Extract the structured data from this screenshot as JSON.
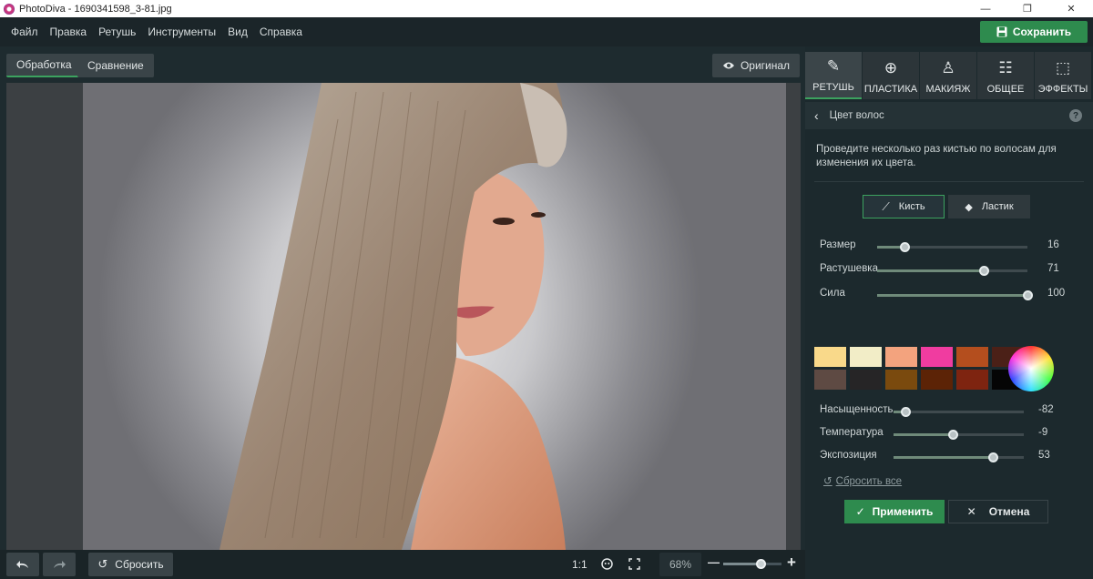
{
  "window": {
    "title": "PhotoDiva - 1690341598_3-81.jpg",
    "minimize": "—",
    "maximize": "❐",
    "close": "✕"
  },
  "menu": [
    "Файл",
    "Правка",
    "Ретушь",
    "Инструменты",
    "Вид",
    "Справка"
  ],
  "save_label": "Сохранить",
  "view_tabs": {
    "processing": "Обработка",
    "compare": "Сравнение"
  },
  "original_label": "Оригинал",
  "bottom": {
    "reset_label": "Сбросить",
    "ratio_label": "1:1",
    "zoom_label": "68%",
    "zoom_value": 0.68,
    "minus": "—",
    "plus": "+"
  },
  "right_tabs": [
    {
      "label": "РЕТУШЬ",
      "icon": "retouch-icon"
    },
    {
      "label": "ПЛАСТИКА",
      "icon": "plastic-icon"
    },
    {
      "label": "МАКИЯЖ",
      "icon": "makeup-icon"
    },
    {
      "label": "ОБЩЕЕ",
      "icon": "sliders-icon"
    },
    {
      "label": "ЭФФЕКТЫ",
      "icon": "effects-icon"
    }
  ],
  "section": {
    "title": "Цвет волос",
    "help": "?",
    "description": "Проведите несколько раз кистью по волосам для изменения их цвета."
  },
  "tools": {
    "brush": "Кисть",
    "eraser": "Ластик"
  },
  "brush_sliders": [
    {
      "label": "Размер",
      "value": "16",
      "fraction": 0.18
    },
    {
      "label": "Растушевка",
      "value": "71",
      "fraction": 0.71
    },
    {
      "label": "Сила",
      "value": "100",
      "fraction": 1.0
    }
  ],
  "swatches": [
    "#f9d98a",
    "#f2edc7",
    "#f3a37e",
    "#f03ca0",
    "#b44e1e",
    "#4b2017",
    "#5e4a43",
    "#262526",
    "#7a4a0e",
    "#5c2306",
    "#7e2410",
    "#050505"
  ],
  "color_sliders": [
    {
      "label": "Насыщенность",
      "value": "-82",
      "fraction": 0.09
    },
    {
      "label": "Температура",
      "value": "-9",
      "fraction": 0.455
    },
    {
      "label": "Экспозиция",
      "value": "53",
      "fraction": 0.765
    }
  ],
  "reset_all_label": "Сбросить все",
  "apply_label": "Применить",
  "cancel_label": "Отмена",
  "colors": {
    "accent_green": "#2e8b4e",
    "panel_bg": "#1c292d"
  }
}
